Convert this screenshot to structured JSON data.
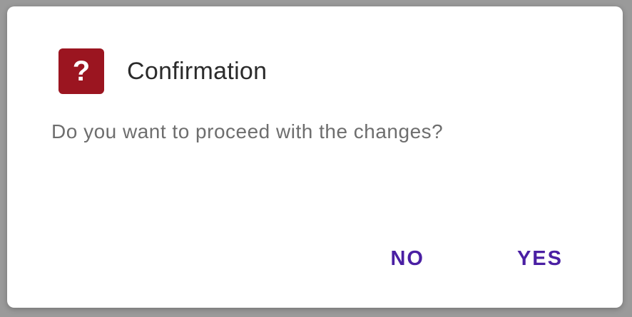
{
  "dialog": {
    "icon": {
      "name": "question-mark-icon",
      "glyph": "?",
      "color": "#9b1520"
    },
    "title": "Confirmation",
    "message": "Do you want to proceed with the changes?",
    "buttons": {
      "no_label": "NO",
      "yes_label": "YES",
      "color": "#4a1fa3"
    }
  }
}
